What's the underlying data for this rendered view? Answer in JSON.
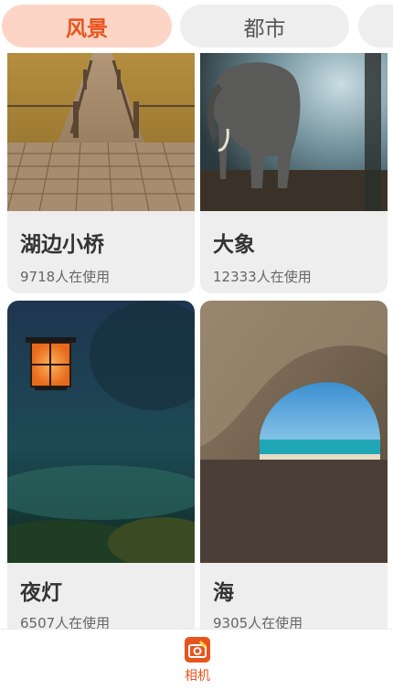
{
  "tabs": [
    {
      "label": "风景",
      "active": true
    },
    {
      "label": "都市",
      "active": false
    },
    {
      "label": "",
      "active": false
    }
  ],
  "cards": [
    {
      "title": "湖边小桥",
      "usage": "9718人在使用",
      "image": "wooden-boardwalk-photo"
    },
    {
      "title": "大象",
      "usage": "12333人在使用",
      "image": "elephant-forest-photo"
    },
    {
      "title": "夜灯",
      "usage": "6507人在使用",
      "image": "night-lantern-photo"
    },
    {
      "title": "海",
      "usage": "9305人在使用",
      "image": "sea-cave-photo"
    }
  ],
  "bottom_nav": {
    "items": [
      {
        "label": "相机",
        "icon": "camera-edit-icon",
        "active": true
      }
    ]
  },
  "colors": {
    "accent": "#e8541e",
    "active_tab_bg": "#fcd5c6",
    "tab_bg": "#eeeeee",
    "card_bg": "#eeeeee"
  }
}
